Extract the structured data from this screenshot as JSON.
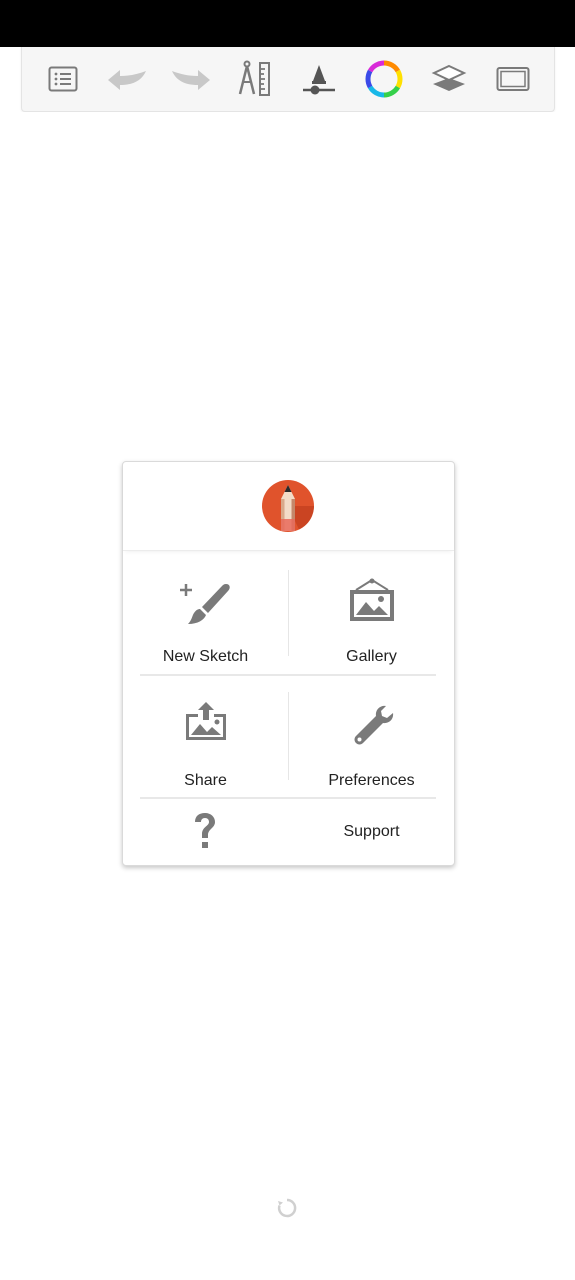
{
  "toolbar": {
    "icons": [
      {
        "name": "list-menu-icon"
      },
      {
        "name": "undo-icon"
      },
      {
        "name": "redo-icon"
      },
      {
        "name": "ruler-compass-icon"
      },
      {
        "name": "brush-size-icon"
      },
      {
        "name": "color-wheel-icon"
      },
      {
        "name": "layers-icon"
      },
      {
        "name": "fullscreen-icon"
      }
    ]
  },
  "menu": {
    "logo": "sketchbook-logo-icon",
    "new_sketch": "New Sketch",
    "gallery": "Gallery",
    "share": "Share",
    "preferences": "Preferences",
    "support": "Support"
  },
  "colors": {
    "icon_gray": "#7a7a7a",
    "disabled_gray": "#c8c8c8",
    "logo_orange": "#e0532c",
    "status_bar": "#000000"
  }
}
